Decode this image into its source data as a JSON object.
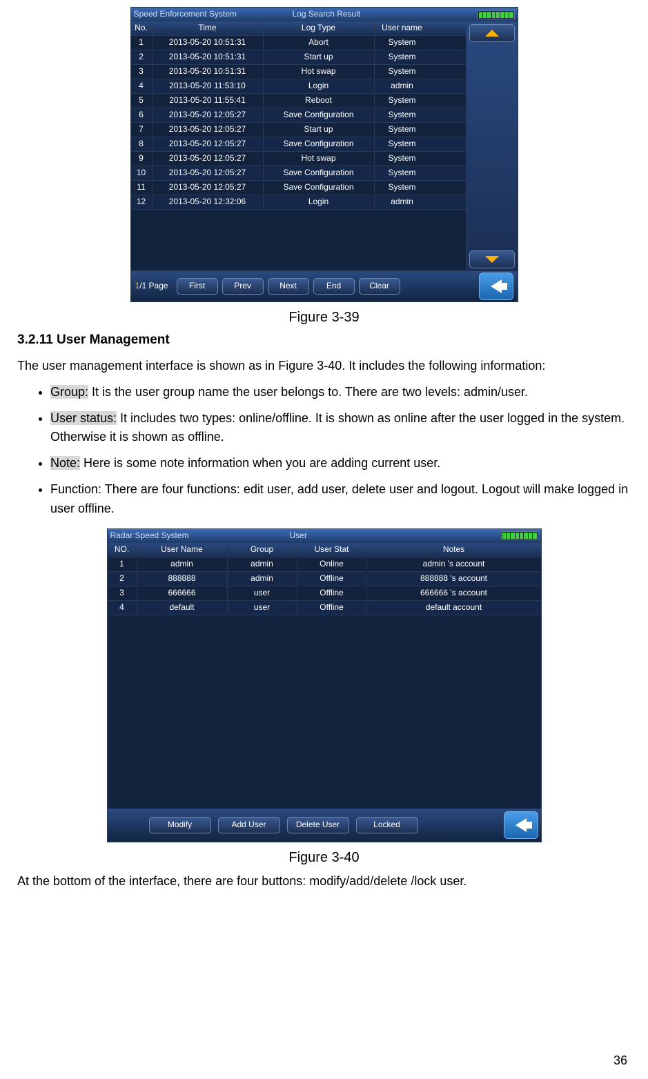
{
  "fig39": {
    "caption": "Figure 3-39",
    "title_left": "Speed Enforcement System",
    "title_right": "Log Search Result",
    "headers": [
      "No.",
      "Time",
      "Log Type",
      "User name"
    ],
    "rows": [
      [
        "1",
        "2013-05-20 10:51:31",
        "Abort",
        "System"
      ],
      [
        "2",
        "2013-05-20 10:51:31",
        "Start up",
        "System"
      ],
      [
        "3",
        "2013-05-20 10:51:31",
        "Hot swap",
        "System"
      ],
      [
        "4",
        "2013-05-20 11:53:10",
        "Login",
        "admin"
      ],
      [
        "5",
        "2013-05-20 11:55:41",
        "Reboot",
        "System"
      ],
      [
        "6",
        "2013-05-20 12:05:27",
        "Save Configuration",
        "System"
      ],
      [
        "7",
        "2013-05-20 12:05:27",
        "Start up",
        "System"
      ],
      [
        "8",
        "2013-05-20 12:05:27",
        "Save Configuration",
        "System"
      ],
      [
        "9",
        "2013-05-20 12:05:27",
        "Hot swap",
        "System"
      ],
      [
        "10",
        "2013-05-20 12:05:27",
        "Save Configuration",
        "System"
      ],
      [
        "11",
        "2013-05-20 12:05:27",
        "Save Configuration",
        "System"
      ],
      [
        "12",
        "2013-05-20 12:32:06",
        "Login",
        "admin"
      ]
    ],
    "pager_current": "1",
    "pager_total": "/1 Page",
    "buttons": {
      "first": "First",
      "prev": "Prev",
      "next": "Next",
      "end": "End",
      "clear": "Clear"
    }
  },
  "section": {
    "heading": "3.2.11 User Management",
    "intro": "The user management interface is shown as in Figure 3-40. It includes the following information:",
    "bullets": [
      {
        "label": "Group:",
        "rest": " It is the user group name the user belongs to. There are two levels: admin/user."
      },
      {
        "label": "User status:",
        "rest": " It includes two types: online/offline. It is shown as online after the user logged in the system. Otherwise it is shown as offline."
      },
      {
        "label": "Note:",
        "rest": " Here is some note information when you are adding current user."
      },
      {
        "label": "Function:",
        "plain": true,
        "rest": " There are four functions: edit user, add user, delete user and logout. Logout will make logged in user offline."
      }
    ]
  },
  "fig40": {
    "caption": "Figure 3-40",
    "title_left": "Radar Speed System",
    "title_center": "User",
    "headers": [
      "NO.",
      "User Name",
      "Group",
      "User Stat",
      "Notes"
    ],
    "rows": [
      [
        "1",
        "admin",
        "admin",
        "Online",
        "admin 's account"
      ],
      [
        "2",
        "888888",
        "admin",
        "Offline",
        "888888 's account"
      ],
      [
        "3",
        "666666",
        "user",
        "Offline",
        "666666 's account"
      ],
      [
        "4",
        "default",
        "user",
        "Offline",
        "default account"
      ]
    ],
    "buttons": {
      "modify": "Modify",
      "add": "Add User",
      "delete": "Delete User",
      "locked": "Locked"
    }
  },
  "closing": "At the bottom of the interface, there are four buttons: modify/add/delete /lock user.",
  "page_number": "36"
}
